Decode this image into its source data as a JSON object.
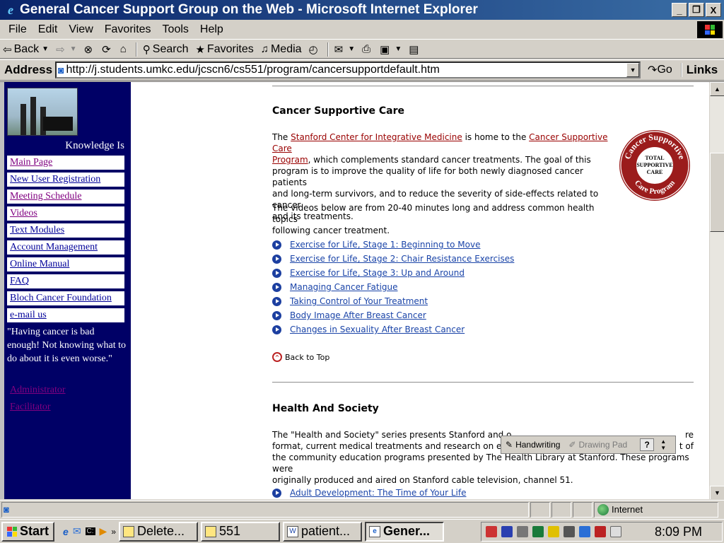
{
  "window": {
    "title": "General Cancer Support Group on the Web - Microsoft Internet Explorer",
    "minimize": "_",
    "maximize": "❐",
    "close": "X"
  },
  "menu": [
    "File",
    "Edit",
    "View",
    "Favorites",
    "Tools",
    "Help"
  ],
  "toolbar": {
    "back": "Back",
    "search": "Search",
    "favorites": "Favorites",
    "media": "Media"
  },
  "address": {
    "label": "Address",
    "url": "http://j.students.umkc.edu/jcscn6/cs551/program/cancersupportdefault.htm",
    "go": "Go",
    "links": "Links"
  },
  "sidebar": {
    "tagline": "Knowledge Is",
    "nav": [
      "Main Page",
      "New User Registration",
      "Meeting Schedule",
      "Videos",
      "Text Modules",
      "Account Management",
      "Online Manual",
      "FAQ",
      "Bloch Cancer Foundation",
      "e-mail us"
    ],
    "quote": "\"Having cancer is bad enough! Not knowing what to do about it is even worse.\"",
    "admin": "Administrator",
    "facilitator": "Facilitator"
  },
  "section1": {
    "heading": "Cancer Supportive Care",
    "p1_a": "The ",
    "p1_link1": "Stanford Center for Integrative Medicine",
    "p1_b": " is home to the ",
    "p1_link2a": "Cancer Supportive Care",
    "p1_link2b": "Program",
    "p1_c": ", which complements standard cancer treatments. The goal of this",
    "p1_d": "program is to improve the quality of life for both newly diagnosed cancer patients",
    "p1_e": "and long-term survivors, and to reduce the severity of side-effects related to cancer",
    "p1_f": "and its treatments.",
    "p2_a": "The videos below are from 20-40 minutes long and address common health topics",
    "p2_b": "following cancer treatment.",
    "seal_top": "Cancer Supportive",
    "seal_center": "TOTAL SUPPORTIVE CARE",
    "seal_bottom": "Care Program",
    "videos": [
      "Exercise for Life, Stage 1: Beginning to Move",
      "Exercise for Life, Stage 2: Chair Resistance Exercises",
      "Exercise for Life, Stage 3: Up and Around",
      "Managing Cancer Fatigue",
      "Taking Control of Your Treatment",
      "Body Image After Breast Cancer",
      "Changes in Sexuality After Breast Cancer"
    ],
    "back_to_top": "Back to Top"
  },
  "section2": {
    "heading": "Health And Society",
    "l1a": "The \"Health and Society\" series presents Stanford and o",
    "l1b": "re",
    "l2a": "format, current medical treatments and research on eme",
    "l2b": "t of",
    "l3": "the community education programs presented by The Health Library at Stanford. These programs were",
    "l4": "originally produced and aired on Stanford cable television, channel 51.",
    "video1": "Adult Development: The Time of Your Life"
  },
  "handwriting": {
    "handwriting": "Handwriting",
    "drawing_pad": "Drawing Pad",
    "help": "?"
  },
  "status": {
    "zone": "Internet"
  },
  "taskbar": {
    "start": "Start",
    "tasks": [
      "Delete...",
      "551",
      "patient...",
      "Gener..."
    ],
    "clock": "8:09 PM"
  }
}
